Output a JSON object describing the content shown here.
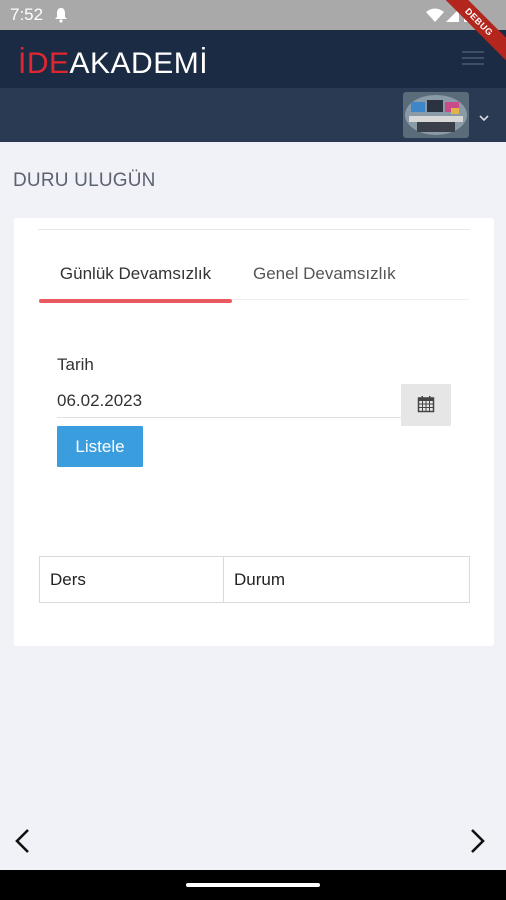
{
  "status_bar": {
    "time": "7:52"
  },
  "debug_banner": "DEBUG",
  "header": {
    "logo_red": "İDE",
    "logo_white": "AKADEMİ"
  },
  "user": {
    "name": "DURU ULUGÜN"
  },
  "tabs": {
    "daily": "Günlük Devamsızlık",
    "general": "Genel Devamsızlık",
    "active": "daily"
  },
  "form": {
    "date_label": "Tarih",
    "date_value": "06.02.2023",
    "list_button": "Listele"
  },
  "table": {
    "columns": [
      "Ders",
      "Durum"
    ]
  },
  "colors": {
    "header_bg": "#1c2b44",
    "subheader_bg": "#2a3a52",
    "accent_red": "#e85a5f",
    "logo_red": "#e0272f",
    "button_blue": "#3a9ede",
    "page_bg": "#f1f2f7"
  },
  "icons": {
    "status_left": "notification-bell-icon",
    "status_right": [
      "wifi-icon",
      "signal-icon",
      "battery-icon"
    ],
    "menu": "hamburger-menu-icon",
    "dropdown": "chevron-down-icon",
    "calendar": "calendar-icon",
    "back": "chevron-left-icon",
    "forward": "chevron-right-icon"
  }
}
